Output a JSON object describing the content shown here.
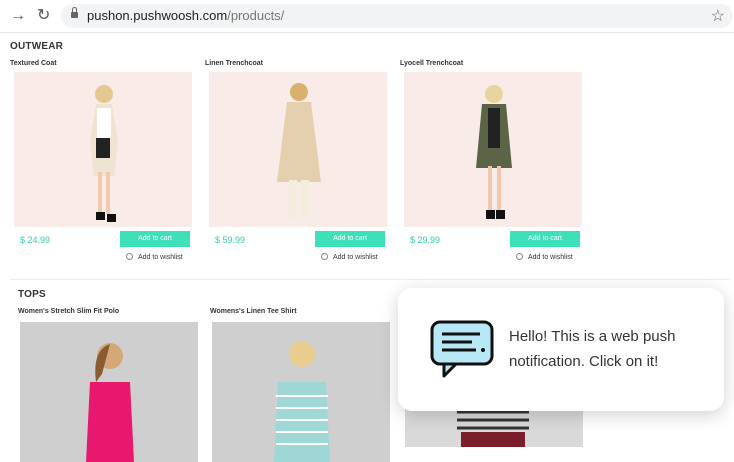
{
  "browser": {
    "url_host": "pushon.pushwoosh.com",
    "url_path": "/products/",
    "icons": [
      "arrow-right-icon",
      "refresh-icon",
      "lock-icon",
      "star-icon"
    ]
  },
  "sections": {
    "outwear": {
      "title": "OUTWEAR",
      "products": [
        {
          "name": "Textured Coat",
          "price": "$ 24.99",
          "add_to_cart": "Add to cart",
          "wishlist": "Add to wishlist"
        },
        {
          "name": "Linen Trenchcoat",
          "price": "$ 59.99",
          "add_to_cart": "Add to cart",
          "wishlist": "Add to wishlist"
        },
        {
          "name": "Lyocell Trenchcoat",
          "price": "$ 29.99",
          "add_to_cart": "Add to cart",
          "wishlist": "Add to wishlist"
        }
      ]
    },
    "tops": {
      "title": "TOPS",
      "products": [
        {
          "name": "Women's Stretch Slim Fit Polo"
        },
        {
          "name": "Womens's Linen Tee Shirt"
        }
      ]
    }
  },
  "notification": {
    "text": "Hello! This is a web push notification. Click on it!",
    "icon": "chat-message-icon"
  },
  "colors": {
    "accent": "#3de0b8",
    "price": "#2fd0a8",
    "photo_bg": "#f9ebe7"
  }
}
